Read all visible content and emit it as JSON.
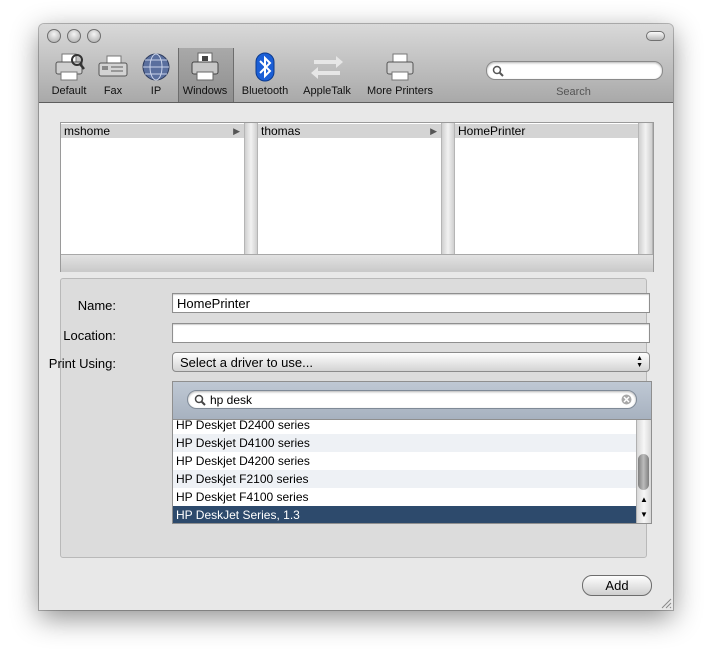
{
  "toolbar": {
    "items": [
      {
        "label": "Default",
        "icon": "default-printer-icon"
      },
      {
        "label": "Fax",
        "icon": "fax-icon"
      },
      {
        "label": "IP",
        "icon": "ip-globe-icon"
      },
      {
        "label": "Windows",
        "icon": "windows-printer-icon",
        "selected": true
      },
      {
        "label": "Bluetooth",
        "icon": "bluetooth-icon"
      },
      {
        "label": "AppleTalk",
        "icon": "appletalk-arrows-icon"
      },
      {
        "label": "More Printers",
        "icon": "more-printers-icon"
      }
    ],
    "search_label": "Search",
    "search_value": ""
  },
  "browser": {
    "columns": [
      {
        "item": "mshome",
        "has_children": true,
        "arrow": "▶"
      },
      {
        "item": "thomas",
        "has_children": true,
        "arrow": "▶"
      },
      {
        "item": "HomePrinter",
        "has_children": false
      }
    ]
  },
  "form": {
    "name_label": "Name:",
    "name_value": "HomePrinter",
    "location_label": "Location:",
    "location_value": "",
    "print_using_label": "Print Using:",
    "print_using_value": "Select a driver to use...",
    "driver_search_value": "hp desk",
    "drivers": [
      "HP Deskjet D2400 series",
      "HP Deskjet D4100 series",
      "HP Deskjet D4200 series",
      "HP Deskjet F2100 series",
      "HP Deskjet F4100 series",
      "HP DeskJet Series, 1.3"
    ],
    "selected_driver": "HP DeskJet Series, 1.3"
  },
  "buttons": {
    "add_label": "Add"
  },
  "colors": {
    "selection": "#2d4a6c",
    "bluetooth": "#1a5ed6"
  }
}
